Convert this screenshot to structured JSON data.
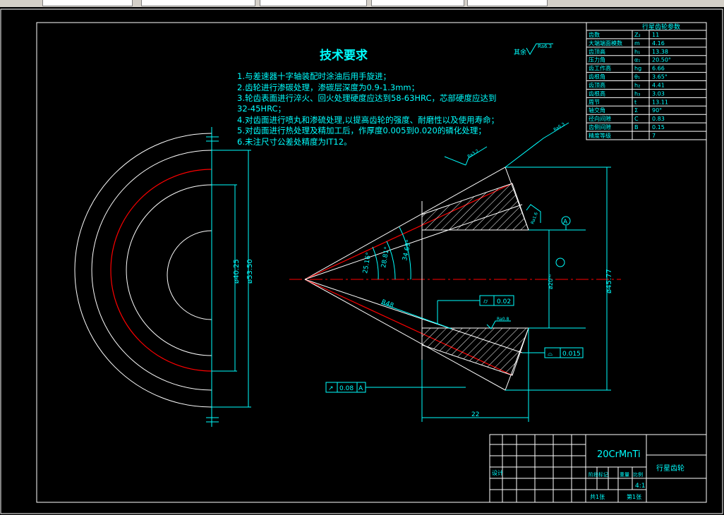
{
  "tech": {
    "title": "技术要求",
    "lines": [
      "1.与差速器十字轴装配时涂油后用手旋进；",
      "2.齿轮进行渗碳处理，渗碳层深度为0.9-1.3mm；",
      "3.轮齿表面进行淬火、回火处理硬度应达到58-63HRC，芯部硬度应达到",
      "32-45HRC；",
      "4.对齿面进行喷丸和渗硫处理,以提高齿轮的强度、耐磨性以及使用寿命；",
      "5.对齿面进行热处理及精加工后，作厚度0.005到0.020的磷化处理；",
      "6.未注尺寸公差处精度为IT12。"
    ]
  },
  "surface": {
    "label": "其余",
    "ra_main": "Ra6.3"
  },
  "param_table": {
    "title": "行星齿轮参数",
    "rows": [
      [
        "齿数",
        "Z₂",
        "11"
      ],
      [
        "大端端面模数",
        "m",
        "4.16"
      ],
      [
        "齿顶高",
        "h₁",
        "13.38"
      ],
      [
        "压力角",
        "α₁",
        "20.50°"
      ],
      [
        "齿工作高",
        "hg",
        "6.66"
      ],
      [
        "齿根角",
        "θ₁",
        "3.65°"
      ],
      [
        "齿顶高",
        "h₂",
        "4.41"
      ],
      [
        "齿根高",
        "h₃",
        "3.03"
      ],
      [
        "周节",
        "t",
        "13.11"
      ],
      [
        "轴交角",
        "Σ",
        "90°"
      ],
      [
        "径向间隙",
        "C",
        "0.83"
      ],
      [
        "齿侧间隙",
        "B",
        "0.15"
      ],
      [
        "精度等级",
        "",
        "7"
      ]
    ]
  },
  "dims": {
    "d1": "ø40.25",
    "d2": "ø53.50",
    "d3": "ø45.77",
    "d4": "ø20ʰ⁰",
    "a1": "25.16°",
    "a2": "28.81°",
    "a3": "34.69°",
    "r": "R48",
    "len": "22",
    "ra_a": "Ra3.2",
    "ra_b": "Ra1.6",
    "ra_c": "Ra6.3",
    "ra_d": "Ra0.8",
    "datum": "A"
  },
  "tolerances": {
    "cyl": "0.02",
    "profile": "0.015",
    "runout": "0.08",
    "runout_ref": "A"
  },
  "title_block": {
    "material": "20CrMnTi",
    "name": "行星齿轮",
    "designer_label": "设计",
    "stage_label": "阶段标记",
    "weight_label": "重量",
    "scale_label": "比例",
    "scale": "4:1",
    "sheets_label": "共1张",
    "sheet_label": "第1张"
  },
  "colors": {
    "bg": "#000000",
    "line": "#ffffff",
    "dim": "#00ffff",
    "red": "#ff0000"
  }
}
